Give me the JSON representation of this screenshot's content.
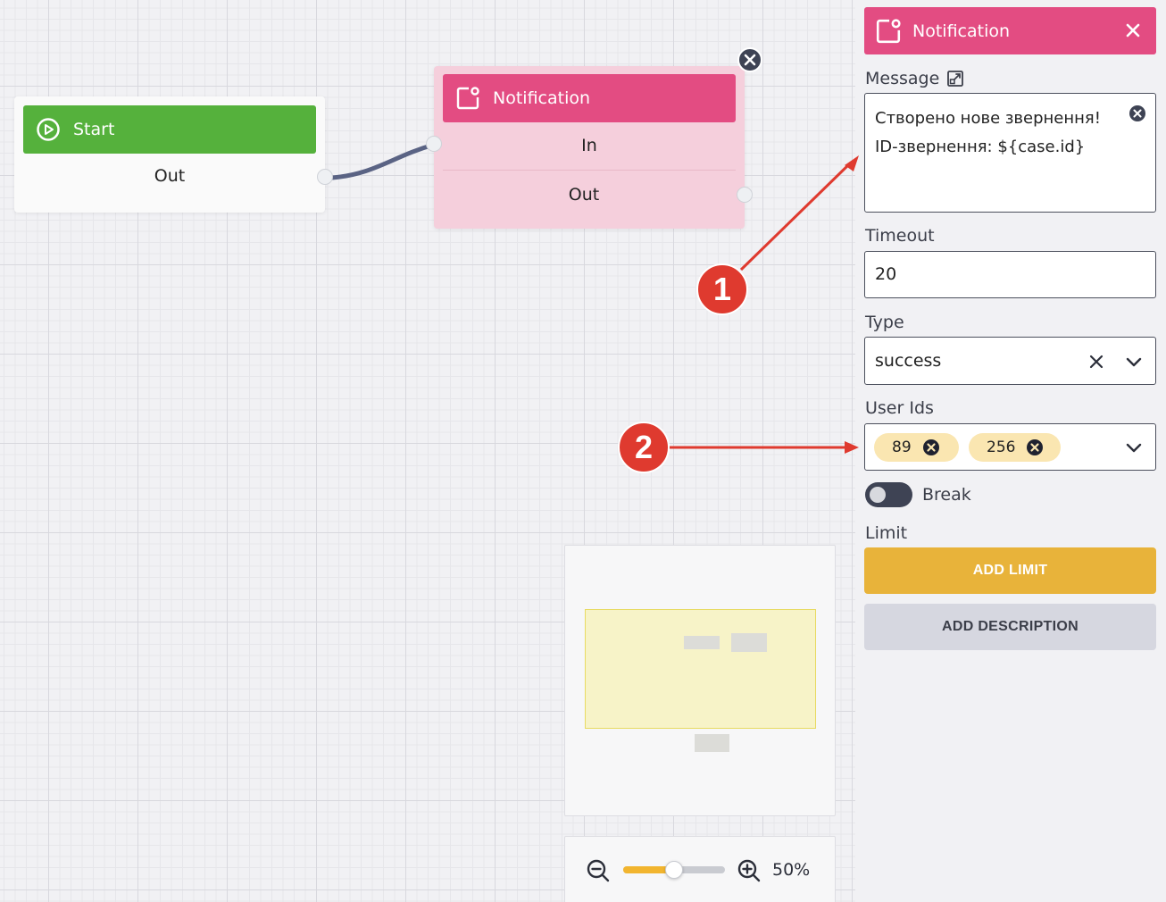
{
  "canvas": {
    "start_node": {
      "title": "Start",
      "out_label": "Out"
    },
    "notification_node": {
      "title": "Notification",
      "in_label": "In",
      "out_label": "Out"
    },
    "zoom": {
      "value": 0.5,
      "label": "50%"
    }
  },
  "panel": {
    "title": "Notification",
    "message": {
      "label": "Message",
      "value": "Створено нове звернення!\nID-звернення: ${case.id}"
    },
    "timeout": {
      "label": "Timeout",
      "value": "20"
    },
    "type": {
      "label": "Type",
      "value": "success"
    },
    "user_ids": {
      "label": "User Ids",
      "values": [
        "89",
        "256"
      ]
    },
    "break_toggle": {
      "label": "Break",
      "on": false
    },
    "limit": {
      "label": "Limit"
    },
    "add_limit_button": "ADD LIMIT",
    "add_description_button": "ADD DESCRIPTION"
  },
  "annotations": [
    "1",
    "2"
  ],
  "colors": {
    "start_green": "#55b13c",
    "notification_pink": "#e34c82",
    "limit_yellow": "#e8b33a",
    "annotation_red": "#df3a2f"
  }
}
